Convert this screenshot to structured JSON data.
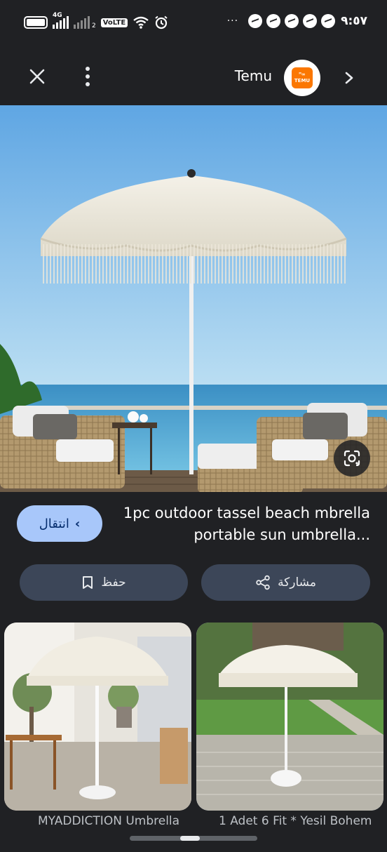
{
  "status_bar": {
    "network_tag": "4G",
    "sim2_tag": "2",
    "volte": "VoLTE",
    "overflow": "···",
    "time": "٩:٥٧"
  },
  "app_bar": {
    "site_name": "Temu",
    "logo_text_top": "ᴴ∞",
    "logo_text": "TEMU"
  },
  "product": {
    "title": "1pc outdoor tassel beach mbrella portable sun umbrella...",
    "goto_label": "انتقال"
  },
  "actions": {
    "save_label": "حفظ",
    "share_label": "مشاركة"
  },
  "related": [
    {
      "caption": "MYADDICTION Umbrella"
    },
    {
      "caption": "1 Adet 6 Fit * Yesil Bohem"
    }
  ],
  "colors": {
    "background": "#202124",
    "accent_button": "#a8c7fa",
    "pill_button": "#3c4658",
    "temu_orange": "#fb7701"
  },
  "icons": [
    "close-icon",
    "more-vert-icon",
    "temu-logo",
    "chevron-right-icon",
    "lens-icon",
    "bookmark-icon",
    "share-icon"
  ]
}
